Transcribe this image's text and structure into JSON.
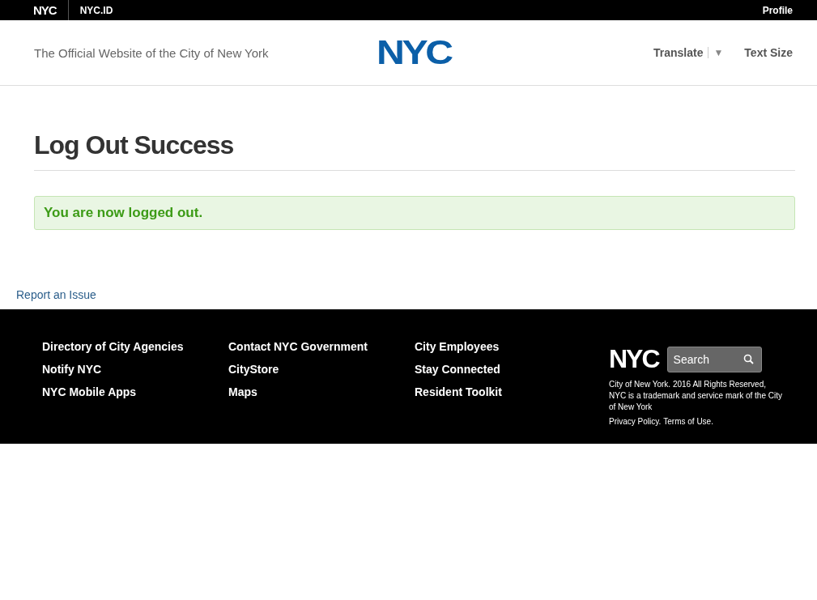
{
  "top_bar": {
    "logo": "NYC",
    "app": "NYC.ID",
    "profile": "Profile"
  },
  "header": {
    "tagline": "The Official Website of the City of New York",
    "logo": "NYC",
    "translate": "Translate",
    "translate_caret": "▼",
    "text_size": "Text Size"
  },
  "page": {
    "title": "Log Out Success",
    "alert": "You are now logged out.",
    "report_link": "Report an Issue"
  },
  "footer": {
    "columns": [
      [
        "Directory of City Agencies",
        "Notify NYC",
        "NYC Mobile Apps"
      ],
      [
        "Contact NYC Government",
        "CityStore",
        "Maps"
      ],
      [
        "City Employees",
        "Stay Connected",
        "Resident Toolkit"
      ]
    ],
    "logo": "NYC",
    "search": {
      "placeholder": "Search"
    },
    "copyright": "City of New York. 2016 All Rights Reserved,",
    "trademark": "NYC is a trademark and service mark of the City of New York",
    "links": [
      "Privacy Policy.",
      "Terms of Use."
    ]
  }
}
